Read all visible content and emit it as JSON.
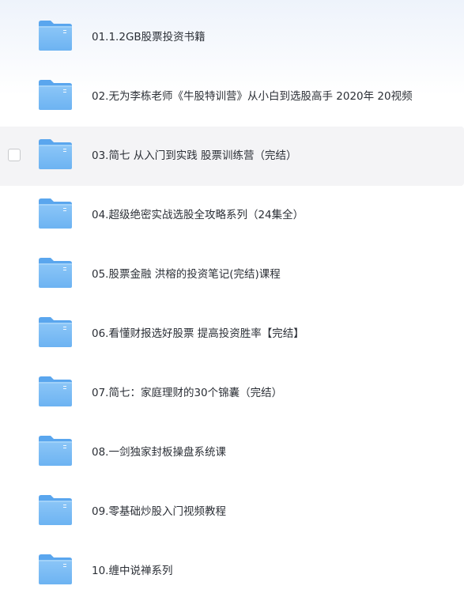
{
  "folders": [
    {
      "name": "01.1.2GB股票投资书籍",
      "selected": false
    },
    {
      "name": "02.无为李栋老师《牛股特训营》从小白到选股高手 2020年 20视频",
      "selected": false
    },
    {
      "name": "03.简七 从入门到实践 股票训练营（完结）",
      "selected": true
    },
    {
      "name": "04.超级绝密实战选股全攻略系列（24集全）",
      "selected": false
    },
    {
      "name": "05.股票金融 洪榕的投资笔记(完结)课程",
      "selected": false
    },
    {
      "name": "06.看懂财报选好股票 提高投资胜率【完结】",
      "selected": false
    },
    {
      "name": "07.简七：家庭理财的30个锦囊（完结）",
      "selected": false
    },
    {
      "name": "08.一剑独家封板操盘系统课",
      "selected": false
    },
    {
      "name": "09.零基础炒股入门视频教程",
      "selected": false
    },
    {
      "name": "10.缠中说禅系列",
      "selected": false
    }
  ],
  "icons": {
    "folder": "folder-icon",
    "checkbox": "checkbox-icon"
  },
  "colors": {
    "folder_body": "#6db3f2",
    "folder_tab": "#5aa6ee",
    "selected_row": "#f4f4f6",
    "text": "#2b2f36"
  }
}
